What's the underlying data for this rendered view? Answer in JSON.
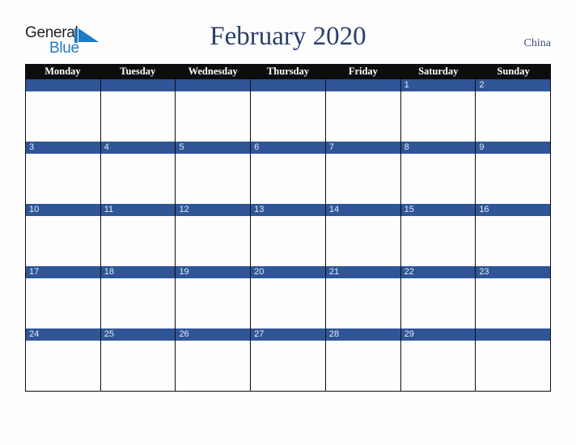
{
  "header": {
    "logo": {
      "line_one": "General",
      "line_two": "Blue",
      "triangle_icon": "triangle-icon",
      "color_text": "#222222",
      "color_blue": "#1f7ac4"
    },
    "title": "February 2020",
    "country": "China",
    "title_color": "#2a3f6b",
    "country_color": "#3b4f7d"
  },
  "calendar": {
    "month": "February",
    "year": "2020",
    "weekday_headers": [
      "Monday",
      "Tuesday",
      "Wednesday",
      "Thursday",
      "Friday",
      "Saturday",
      "Sunday"
    ],
    "header_bg": "#0d0d0d",
    "header_text_color": "#ffffff",
    "date_band_color": "#2f5597",
    "date_text_color": "#e8ecf5",
    "cell_bg": "#fdfdfd",
    "border_color": "#0d0d0d",
    "weeks": [
      [
        {
          "date": ""
        },
        {
          "date": ""
        },
        {
          "date": ""
        },
        {
          "date": ""
        },
        {
          "date": ""
        },
        {
          "date": "1"
        },
        {
          "date": "2"
        }
      ],
      [
        {
          "date": "3"
        },
        {
          "date": "4"
        },
        {
          "date": "5"
        },
        {
          "date": "6"
        },
        {
          "date": "7"
        },
        {
          "date": "8"
        },
        {
          "date": "9"
        }
      ],
      [
        {
          "date": "10"
        },
        {
          "date": "11"
        },
        {
          "date": "12"
        },
        {
          "date": "13"
        },
        {
          "date": "14"
        },
        {
          "date": "15"
        },
        {
          "date": "16"
        }
      ],
      [
        {
          "date": "17"
        },
        {
          "date": "18"
        },
        {
          "date": "19"
        },
        {
          "date": "20"
        },
        {
          "date": "21"
        },
        {
          "date": "22"
        },
        {
          "date": "23"
        }
      ],
      [
        {
          "date": "24"
        },
        {
          "date": "25"
        },
        {
          "date": "26"
        },
        {
          "date": "27"
        },
        {
          "date": "28"
        },
        {
          "date": "29"
        },
        {
          "date": ""
        }
      ]
    ]
  }
}
